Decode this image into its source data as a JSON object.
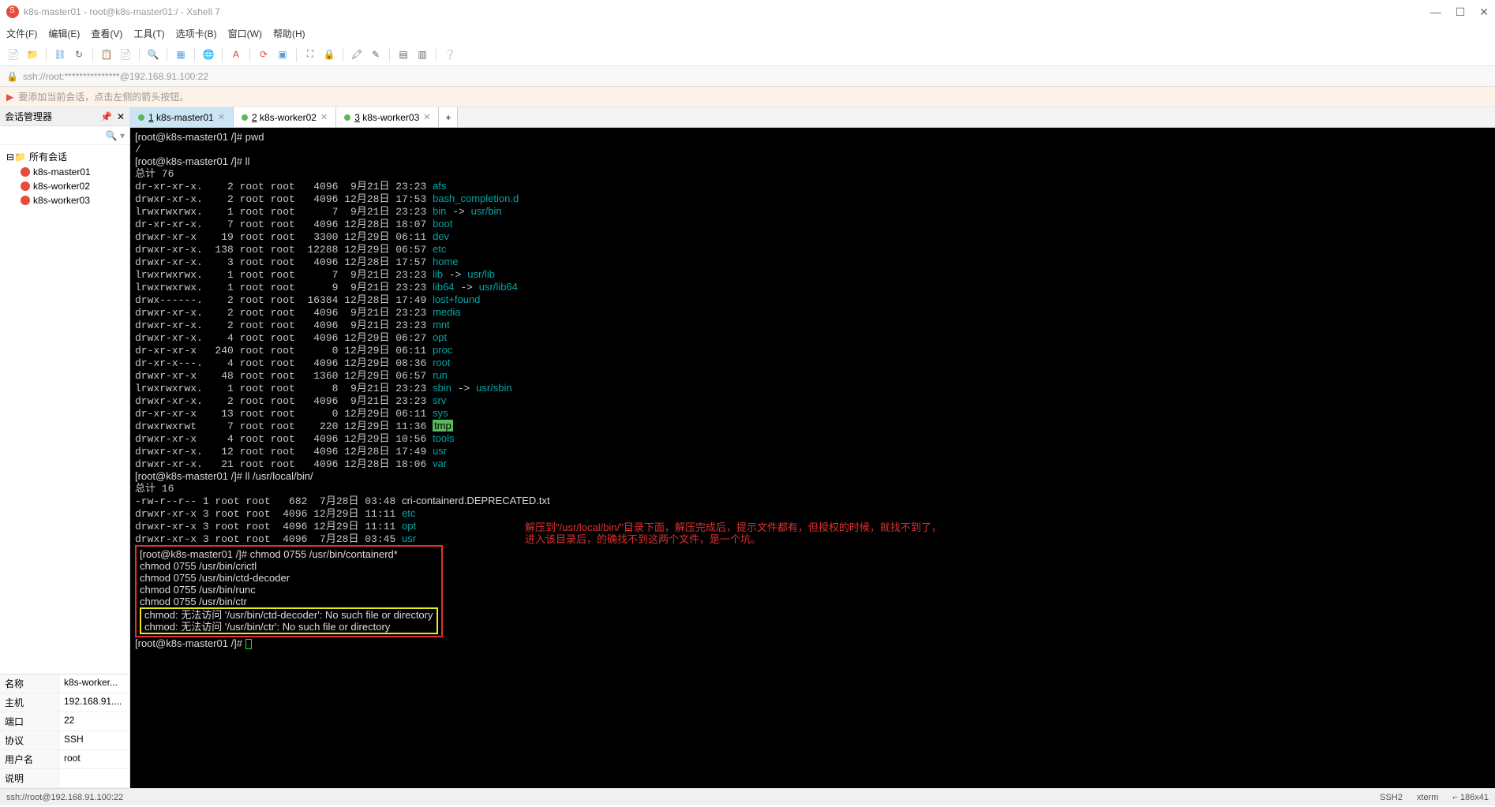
{
  "titlebar": {
    "text": "k8s-master01 - root@k8s-master01:/ - Xshell 7"
  },
  "menu": {
    "file": "文件(F)",
    "edit": "编辑(E)",
    "view": "查看(V)",
    "tools": "工具(T)",
    "tabs": "选项卡(B)",
    "window": "窗口(W)",
    "help": "帮助(H)"
  },
  "addressbar": {
    "text": "ssh://root:***************@192.168.91.100:22"
  },
  "infobar": {
    "text": "要添加当前会话，点击左侧的箭头按钮。"
  },
  "sidebar": {
    "title": "会话管理器",
    "root": "所有会话",
    "hosts": [
      "k8s-master01",
      "k8s-worker02",
      "k8s-worker03"
    ]
  },
  "props": {
    "rows": [
      {
        "label": "名称",
        "value": "k8s-worker..."
      },
      {
        "label": "主机",
        "value": "192.168.91...."
      },
      {
        "label": "端口",
        "value": "22"
      },
      {
        "label": "协议",
        "value": "SSH"
      },
      {
        "label": "用户名",
        "value": "root"
      },
      {
        "label": "说明",
        "value": ""
      }
    ]
  },
  "tabs": {
    "items": [
      {
        "num": "1",
        "label": "k8s-master01",
        "active": true
      },
      {
        "num": "2",
        "label": "k8s-worker02",
        "active": false
      },
      {
        "num": "3",
        "label": "k8s-worker03",
        "active": false
      }
    ]
  },
  "terminal": {
    "prompt1": "[root@k8s-master01 /]# pwd",
    "line_slash": "/",
    "prompt2": "[root@k8s-master01 /]# ll",
    "total1": "总计 76",
    "ls1": [
      {
        "perm": "dr-xr-xr-x.",
        "n": "   2",
        "own": "root root",
        "size": "  4096",
        "date": " 9月21日 23:23",
        "name": "afs",
        "link": ""
      },
      {
        "perm": "drwxr-xr-x.",
        "n": "   2",
        "own": "root root",
        "size": "  4096",
        "date": "12月28日 17:53",
        "name": "bash_completion.d",
        "link": ""
      },
      {
        "perm": "lrwxrwxrwx.",
        "n": "   1",
        "own": "root root",
        "size": "     7",
        "date": " 9月21日 23:23",
        "name": "bin",
        "link": " -> usr/bin"
      },
      {
        "perm": "dr-xr-xr-x.",
        "n": "   7",
        "own": "root root",
        "size": "  4096",
        "date": "12月28日 18:07",
        "name": "boot",
        "link": ""
      },
      {
        "perm": "drwxr-xr-x",
        "n": "   19",
        "own": "root root",
        "size": "  3300",
        "date": "12月29日 06:11",
        "name": "dev",
        "link": ""
      },
      {
        "perm": "drwxr-xr-x.",
        "n": " 138",
        "own": "root root",
        "size": " 12288",
        "date": "12月29日 06:57",
        "name": "etc",
        "link": ""
      },
      {
        "perm": "drwxr-xr-x.",
        "n": "   3",
        "own": "root root",
        "size": "  4096",
        "date": "12月28日 17:57",
        "name": "home",
        "link": ""
      },
      {
        "perm": "lrwxrwxrwx.",
        "n": "   1",
        "own": "root root",
        "size": "     7",
        "date": " 9月21日 23:23",
        "name": "lib",
        "link": " -> usr/lib"
      },
      {
        "perm": "lrwxrwxrwx.",
        "n": "   1",
        "own": "root root",
        "size": "     9",
        "date": " 9月21日 23:23",
        "name": "lib64",
        "link": " -> usr/lib64"
      },
      {
        "perm": "drwx------.",
        "n": "   2",
        "own": "root root",
        "size": " 16384",
        "date": "12月28日 17:49",
        "name": "lost+found",
        "link": ""
      },
      {
        "perm": "drwxr-xr-x.",
        "n": "   2",
        "own": "root root",
        "size": "  4096",
        "date": " 9月21日 23:23",
        "name": "media",
        "link": ""
      },
      {
        "perm": "drwxr-xr-x.",
        "n": "   2",
        "own": "root root",
        "size": "  4096",
        "date": " 9月21日 23:23",
        "name": "mnt",
        "link": ""
      },
      {
        "perm": "drwxr-xr-x.",
        "n": "   4",
        "own": "root root",
        "size": "  4096",
        "date": "12月29日 06:27",
        "name": "opt",
        "link": ""
      },
      {
        "perm": "dr-xr-xr-x",
        "n": "  240",
        "own": "root root",
        "size": "     0",
        "date": "12月29日 06:11",
        "name": "proc",
        "link": ""
      },
      {
        "perm": "dr-xr-x---.",
        "n": "   4",
        "own": "root root",
        "size": "  4096",
        "date": "12月29日 08:36",
        "name": "root",
        "link": ""
      },
      {
        "perm": "drwxr-xr-x",
        "n": "   48",
        "own": "root root",
        "size": "  1360",
        "date": "12月29日 06:57",
        "name": "run",
        "link": ""
      },
      {
        "perm": "lrwxrwxrwx.",
        "n": "   1",
        "own": "root root",
        "size": "     8",
        "date": " 9月21日 23:23",
        "name": "sbin",
        "link": " -> usr/sbin"
      },
      {
        "perm": "drwxr-xr-x.",
        "n": "   2",
        "own": "root root",
        "size": "  4096",
        "date": " 9月21日 23:23",
        "name": "srv",
        "link": ""
      },
      {
        "perm": "dr-xr-xr-x",
        "n": "   13",
        "own": "root root",
        "size": "     0",
        "date": "12月29日 06:11",
        "name": "sys",
        "link": ""
      },
      {
        "perm": "drwxrwxrwt",
        "n": "    7",
        "own": "root root",
        "size": "   220",
        "date": "12月29日 11:36",
        "name": "tmp",
        "link": "",
        "hl": true
      },
      {
        "perm": "drwxr-xr-x",
        "n": "    4",
        "own": "root root",
        "size": "  4096",
        "date": "12月29日 10:56",
        "name": "tools",
        "link": ""
      },
      {
        "perm": "drwxr-xr-x.",
        "n": "  12",
        "own": "root root",
        "size": "  4096",
        "date": "12月28日 17:49",
        "name": "usr",
        "link": ""
      },
      {
        "perm": "drwxr-xr-x.",
        "n": "  21",
        "own": "root root",
        "size": "  4096",
        "date": "12月28日 18:06",
        "name": "var",
        "link": ""
      }
    ],
    "prompt3": "[root@k8s-master01 /]# ll /usr/local/bin/",
    "total2": "总计 16",
    "ls2": [
      {
        "perm": "-rw-r--r--",
        "n": " 1",
        "own": "root root",
        "size": "  682",
        "date": " 7月28日 03:48",
        "name": "cri-containerd.DEPRECATED.txt",
        "cyan": false
      },
      {
        "perm": "drwxr-xr-x",
        "n": " 3",
        "own": "root root",
        "size": " 4096",
        "date": "12月29日 11:11",
        "name": "etc",
        "cyan": true
      },
      {
        "perm": "drwxr-xr-x",
        "n": " 3",
        "own": "root root",
        "size": " 4096",
        "date": "12月29日 11:11",
        "name": "opt",
        "cyan": true
      },
      {
        "perm": "drwxr-xr-x",
        "n": " 3",
        "own": "root root",
        "size": " 4096",
        "date": " 7月28日 03:45",
        "name": "usr",
        "cyan": true
      }
    ],
    "chmod_block": [
      "[root@k8s-master01 /]# chmod 0755 /usr/bin/containerd*",
      "chmod 0755 /usr/bin/crictl",
      "chmod 0755 /usr/bin/ctd-decoder",
      "chmod 0755 /usr/bin/runc",
      "chmod 0755 /usr/bin/ctr"
    ],
    "error_block": [
      "chmod: 无法访问 '/usr/bin/ctd-decoder': No such file or directory",
      "chmod: 无法访问 '/usr/bin/ctr': No such file or directory"
    ],
    "prompt4": "[root@k8s-master01 /]# ",
    "annotation": {
      "line1": "解压到\"/usr/local/bin/\"目录下面，解压完成后，提示文件都有，但授权的时候，就找不到了，",
      "line2": "进入该目录后，的确找不到这两个文件，是一个坑。"
    }
  },
  "statusbar": {
    "left": "ssh://root@192.168.91.100:22",
    "ssh": "SSH2",
    "term": "xterm",
    "size": "186x41"
  }
}
